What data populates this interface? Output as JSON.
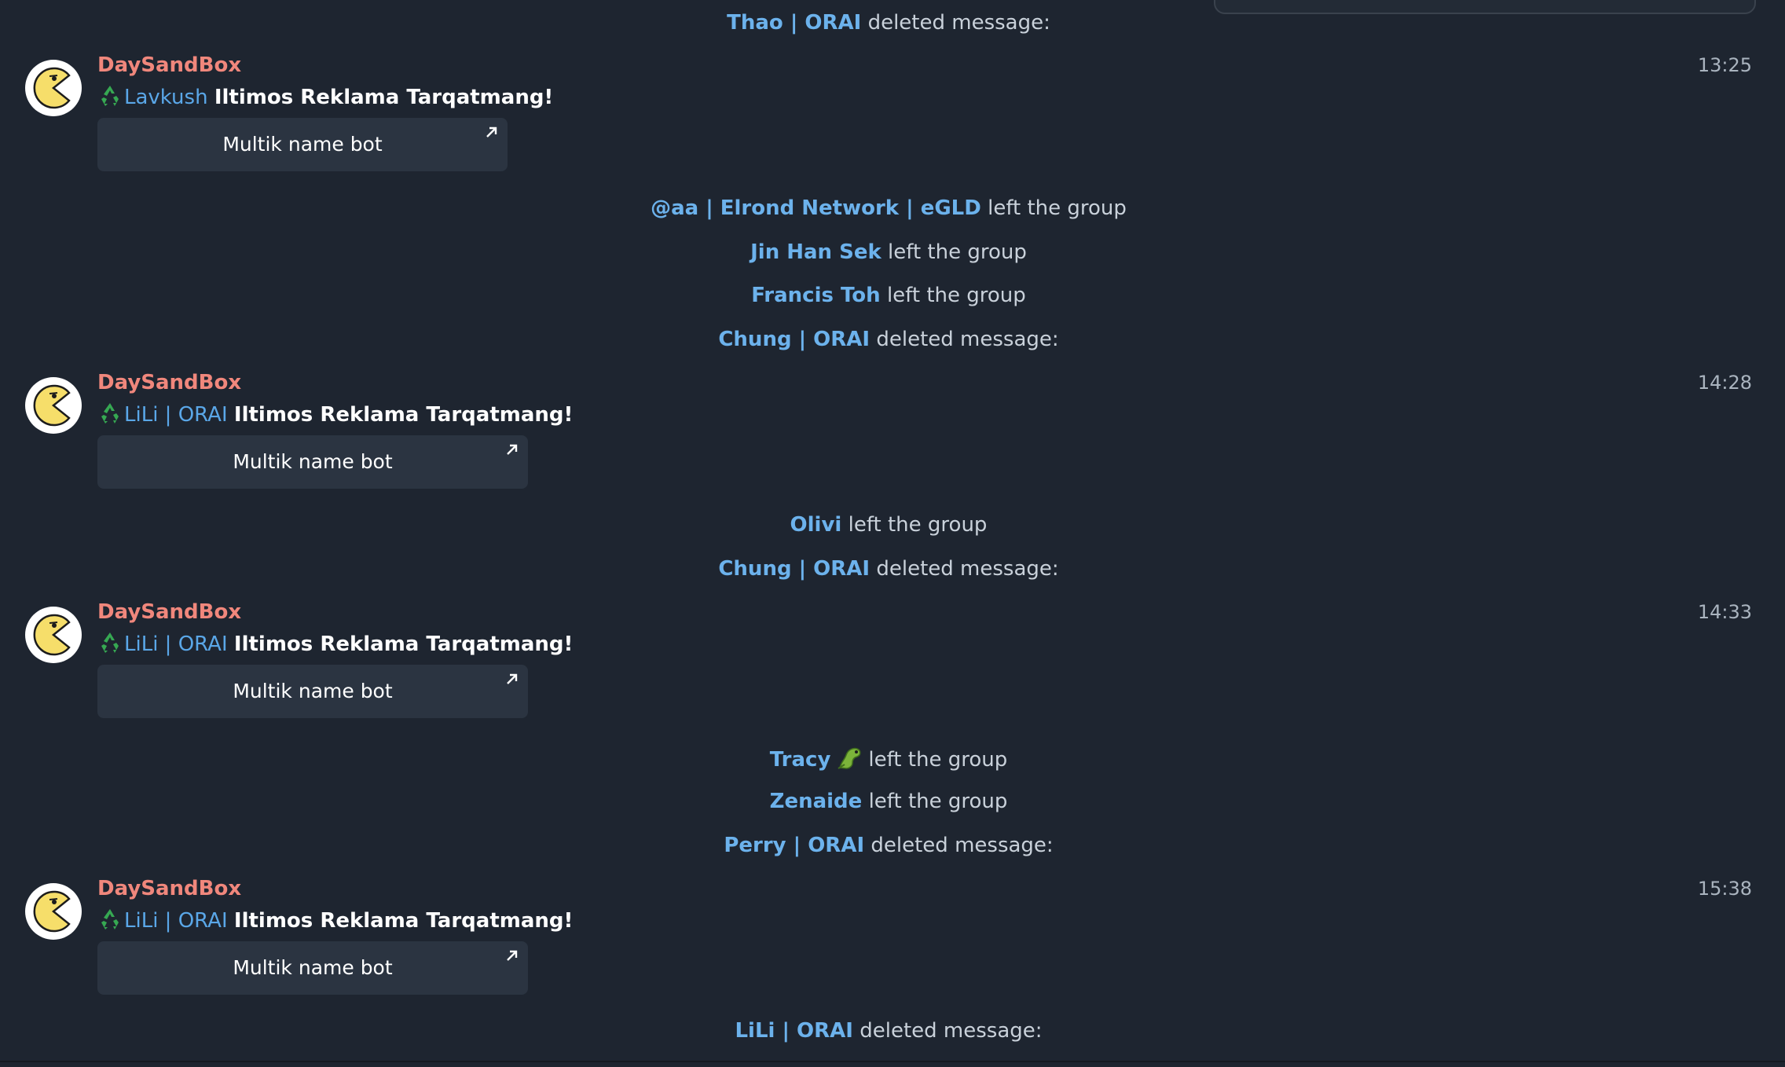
{
  "service_messages": [
    {
      "name": "Thao | ORAI",
      "text": "deleted message:"
    },
    {
      "name": "@aa | Elrond Network | eGLD",
      "text": "left the group"
    },
    {
      "name": "Jin Han Sek",
      "text": "left the group"
    },
    {
      "name": "Francis Toh",
      "text": "left the group"
    },
    {
      "name": "Chung | ORAI",
      "text": "deleted message:"
    },
    {
      "name": "Olivi",
      "text": "left the group"
    },
    {
      "name": "Chung | ORAI",
      "text": "deleted message:"
    },
    {
      "name": "Tracy",
      "text": "left the group"
    },
    {
      "name": "Zenaide",
      "text": "left the group"
    },
    {
      "name": "Perry | ORAI",
      "text": "deleted message:"
    },
    {
      "name": "LiLi | ORAI",
      "text": "deleted message:"
    }
  ],
  "messages": [
    {
      "sender": "DaySandBox",
      "time": "13:25",
      "mention": "Lavkush",
      "text": "Iltimos Reklama Tarqatmang!",
      "button": "Multik name bot"
    },
    {
      "sender": "DaySandBox",
      "time": "14:28",
      "mention": "LiLi | ORAI",
      "text": "Iltimos Reklama Tarqatmang!",
      "button": "Multik name bot"
    },
    {
      "sender": "DaySandBox",
      "time": "14:33",
      "mention": "LiLi | ORAI",
      "text": "Iltimos Reklama Tarqatmang!",
      "button": "Multik name bot"
    },
    {
      "sender": "DaySandBox",
      "time": "15:38",
      "mention": "LiLi | ORAI",
      "text": "Iltimos Reklama Tarqatmang!",
      "button": "Multik name bot"
    }
  ],
  "icons": {
    "avatar": "pacman-avatar-icon",
    "recycle": "recycle-emoji-icon",
    "button_arrow": "external-arrow-icon",
    "tracy_emoji": "dinosaur-emoji-icon"
  },
  "colors": {
    "background": "#1e2530",
    "sender": "#f0877c",
    "name_link": "#6cb2ec",
    "button_bg": "#2b3441"
  }
}
